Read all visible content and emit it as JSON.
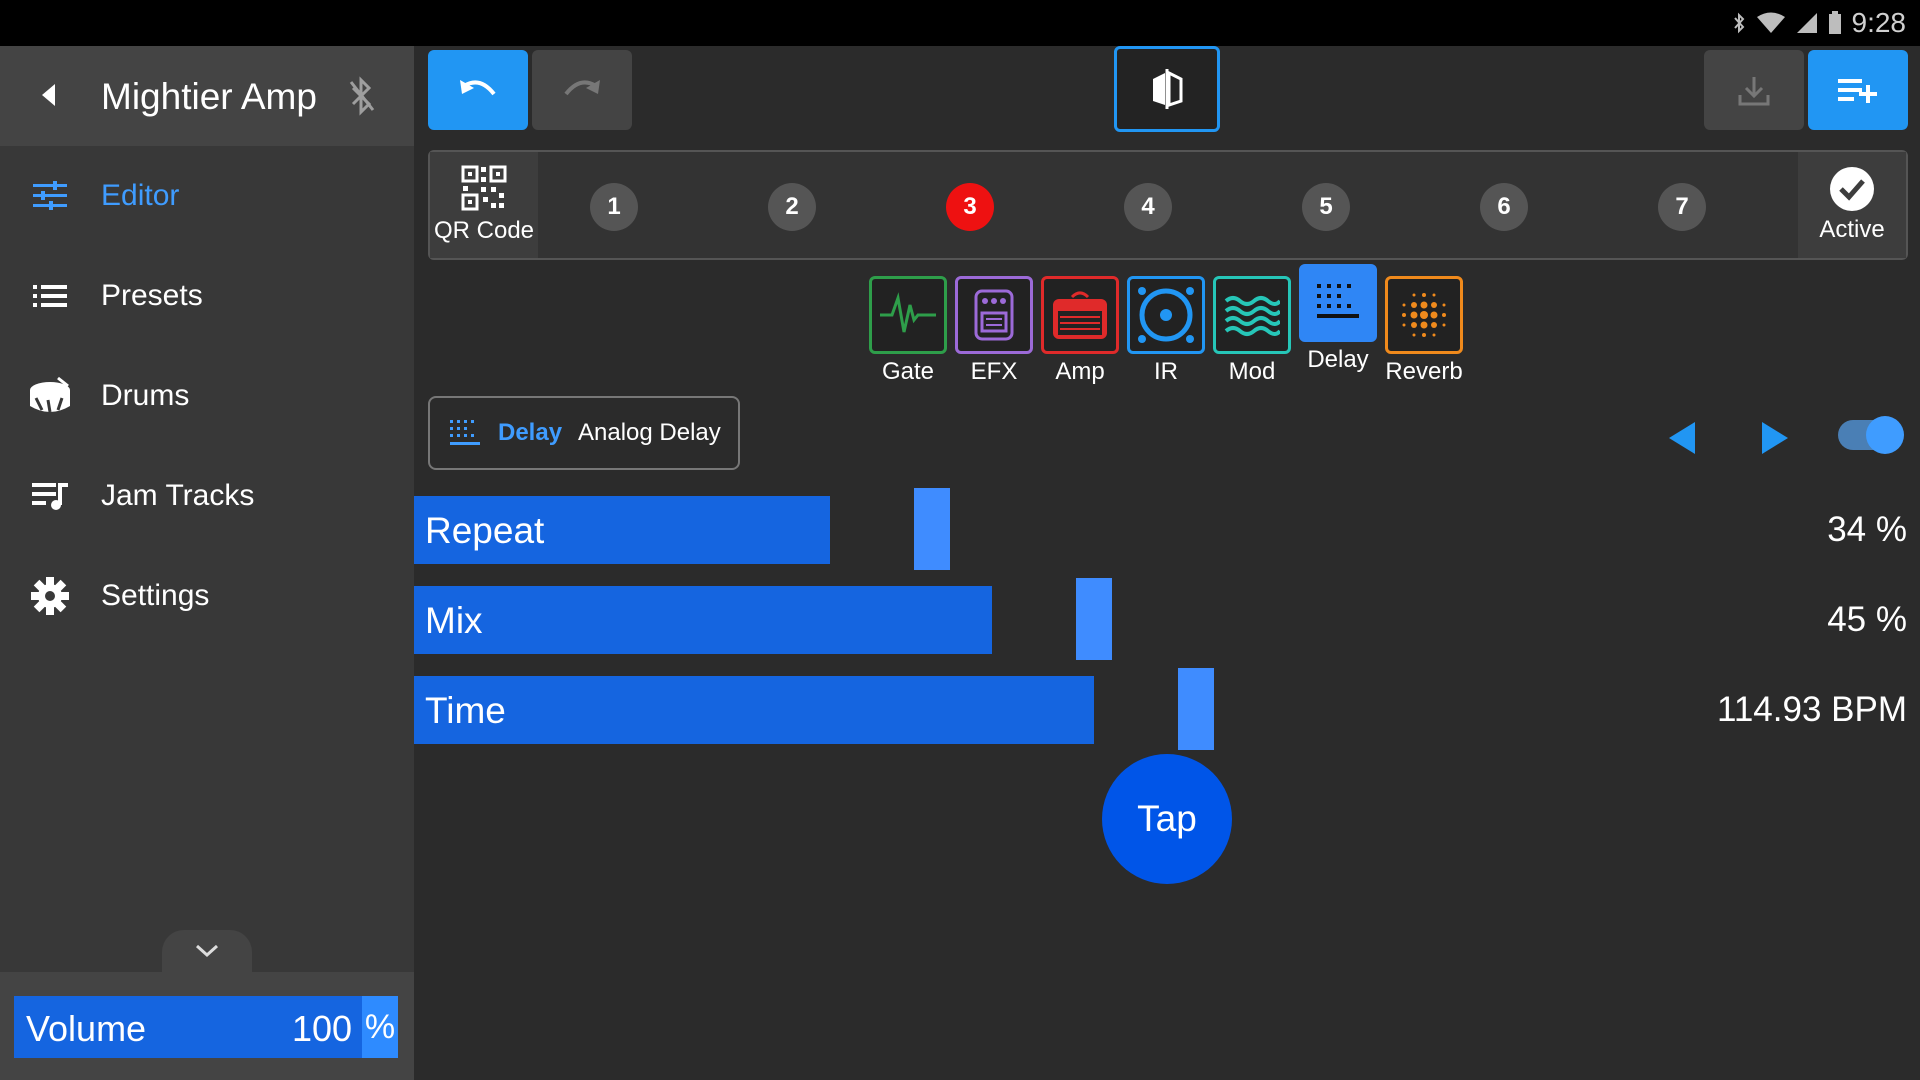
{
  "status_bar": {
    "time": "9:28"
  },
  "sidebar": {
    "title": "Mightier Amp",
    "items": [
      {
        "label": "Editor",
        "icon": "sliders-icon",
        "active": true
      },
      {
        "label": "Presets",
        "icon": "list-icon"
      },
      {
        "label": "Drums",
        "icon": "drum-icon"
      },
      {
        "label": "Jam Tracks",
        "icon": "playlist-icon"
      },
      {
        "label": "Settings",
        "icon": "gear-icon"
      }
    ],
    "volume": {
      "label": "Volume",
      "value": "100",
      "unit": "%"
    }
  },
  "preset_strip": {
    "qr_label": "QR Code",
    "slots": [
      "1",
      "2",
      "3",
      "4",
      "5",
      "6",
      "7"
    ],
    "selected_slot": "3",
    "active_label": "Active"
  },
  "chain": [
    {
      "label": "Gate",
      "color": "#2e9e4a"
    },
    {
      "label": "EFX",
      "color": "#9c6ad8"
    },
    {
      "label": "Amp",
      "color": "#e02a2a"
    },
    {
      "label": "IR",
      "color": "#2196f3"
    },
    {
      "label": "Mod",
      "color": "#26c6b8"
    },
    {
      "label": "Delay",
      "color": "#2f86f5",
      "selected": true
    },
    {
      "label": "Reverb",
      "color": "#f08a1c"
    }
  ],
  "effect": {
    "category": "Delay",
    "name": "Analog Delay",
    "enabled": true
  },
  "params": [
    {
      "label": "Repeat",
      "value": "34 %",
      "level": 0.34
    },
    {
      "label": "Mix",
      "value": "45 %",
      "level": 0.45
    },
    {
      "label": "Time",
      "value": "114.93 BPM",
      "level": 0.52
    }
  ],
  "tap_label": "Tap",
  "colors": {
    "accent": "#2196f3",
    "slider_fill": "#1565e0",
    "selected_slot": "#ee1111"
  }
}
